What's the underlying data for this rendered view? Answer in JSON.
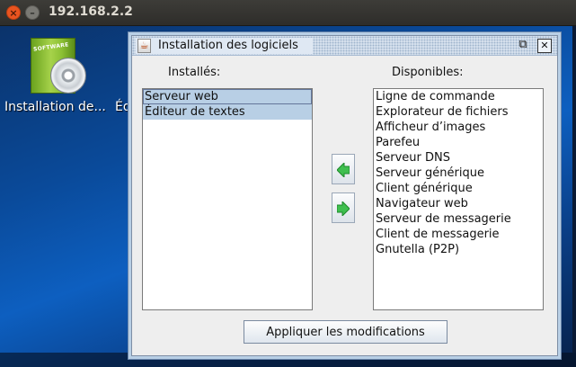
{
  "host_window": {
    "title": "192.168.2.2",
    "close_glyph": "×",
    "minimize_glyph": "–"
  },
  "desktop": {
    "icon_box_text": "SOFTWARE",
    "icon_label": "Installation de...",
    "second_label": "Éd"
  },
  "dialog": {
    "title": "Installation des logiciels",
    "app_icon_glyph": "☕",
    "restore_glyph": "⧉",
    "close_glyph": "✕",
    "installed_label": "Installés:",
    "available_label": "Disponibles:",
    "installed_items": [
      {
        "label": "Serveur web",
        "selected": true
      },
      {
        "label": "Éditeur de textes",
        "selected": true
      }
    ],
    "available_items": [
      "Ligne de commande",
      "Explorateur de fichiers",
      "Afficheur d’images",
      "Parefeu",
      "Serveur DNS",
      "Serveur générique",
      "Client générique",
      "Navigateur web",
      "Serveur de messagerie",
      "Client de messagerie",
      "Gnutella (P2P)"
    ],
    "apply_label": "Appliquer les modifications"
  },
  "colors": {
    "selection": "#b8cfe5",
    "arrow_green": "#3fbf4f"
  }
}
